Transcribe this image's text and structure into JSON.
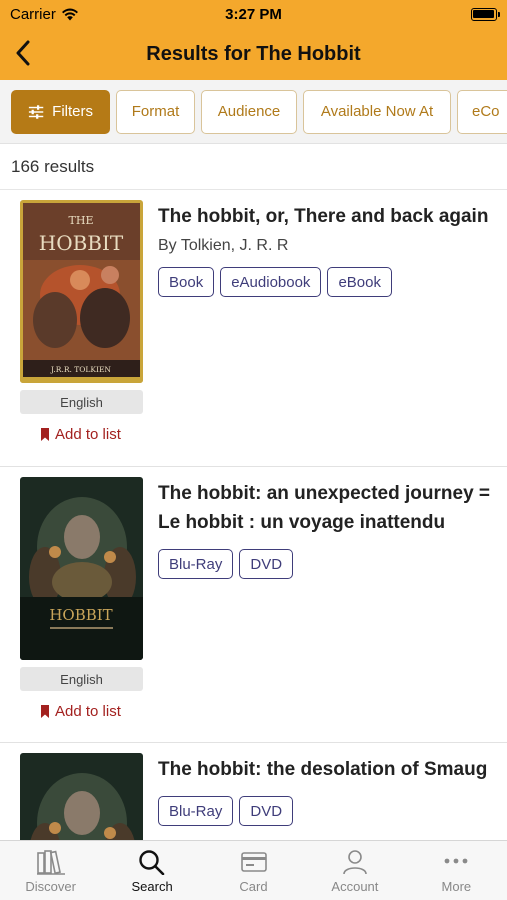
{
  "status_bar": {
    "carrier": "Carrier",
    "time": "3:27 PM"
  },
  "header": {
    "title": "Results for The Hobbit"
  },
  "filters": [
    {
      "label": "Filters"
    },
    {
      "label": "Format"
    },
    {
      "label": "Audience"
    },
    {
      "label": "Available Now At"
    },
    {
      "label": "eCo"
    }
  ],
  "results_count": "166 results",
  "items": [
    {
      "title": "The hobbit, or, There and back again",
      "author": "By Tolkien, J. R. R",
      "formats": [
        "Book",
        "eAudiobook",
        "eBook"
      ],
      "language": "English",
      "add_to_list": "Add to list",
      "cover": {
        "top_text": "THE",
        "main_text": "HOBBIT",
        "bottom_text": "J.R.R. TOLKIEN"
      }
    },
    {
      "title": "The hobbit: an unexpected journey = Le hobbit : un voyage inattendu",
      "author": "",
      "formats": [
        "Blu-Ray",
        "DVD"
      ],
      "language": "English",
      "add_to_list": "Add to list",
      "cover": {
        "main_text": "HOBBIT"
      }
    },
    {
      "title": "The hobbit: the desolation of Smaug",
      "author": "",
      "formats": [
        "Blu-Ray",
        "DVD"
      ]
    }
  ],
  "tabs": [
    {
      "label": "Discover",
      "icon": "books-icon"
    },
    {
      "label": "Search",
      "icon": "search-icon"
    },
    {
      "label": "Card",
      "icon": "card-icon"
    },
    {
      "label": "Account",
      "icon": "person-icon"
    },
    {
      "label": "More",
      "icon": "more-icon"
    }
  ],
  "colors": {
    "header": "#f4a82c",
    "filter_primary": "#b57a16",
    "format_border": "#3f3d7a",
    "add_to_list": "#a3211f"
  }
}
